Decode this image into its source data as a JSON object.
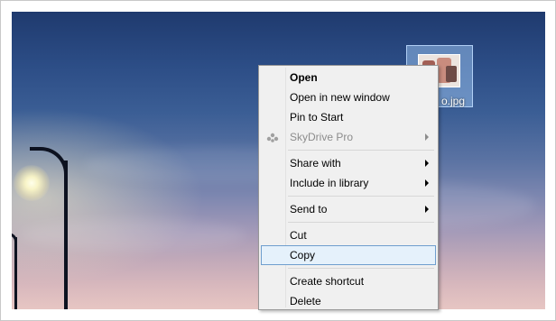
{
  "desktop": {
    "file": {
      "name": "o.jpg",
      "icon": "image-thumbnail-icon"
    }
  },
  "context_menu": {
    "items": [
      {
        "label": "Open",
        "bold": true
      },
      {
        "label": "Open in new window"
      },
      {
        "label": "Pin to Start"
      },
      {
        "label": "SkyDrive Pro",
        "disabled": true,
        "submenu": true,
        "icon": "skydrive-pro-icon"
      },
      {
        "label": "Share with",
        "submenu": true
      },
      {
        "label": "Include in library",
        "submenu": true
      },
      {
        "label": "Send to",
        "submenu": true
      },
      {
        "label": "Cut"
      },
      {
        "label": "Copy",
        "highlighted": true
      },
      {
        "label": "Create shortcut"
      },
      {
        "label": "Delete"
      }
    ]
  },
  "colors": {
    "menu_background": "#f0f0f0",
    "menu_highlight": "#e5f1fb",
    "menu_highlight_border": "#6e9ece",
    "disabled_text": "#8c8c8c"
  }
}
